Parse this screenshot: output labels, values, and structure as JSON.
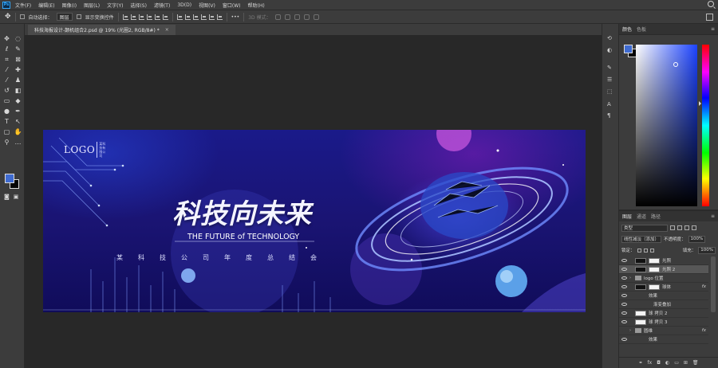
{
  "menubar": {
    "app_icon": "Ps",
    "items": [
      "文件(F)",
      "编辑(E)",
      "图像(I)",
      "图层(L)",
      "文字(Y)",
      "选择(S)",
      "滤镜(T)",
      "3D(D)",
      "视图(V)",
      "窗口(W)",
      "帮助(H)"
    ]
  },
  "options": {
    "auto_select_label": "自动选择：",
    "auto_select_value": "图层",
    "show_transform_label": "显示变换控件",
    "mode_3d_label": "3D 模式："
  },
  "document": {
    "tab_title": "科技海报设计-颠机组合2.psd @ 19% (光圈2, RGB/8#) *",
    "close_glyph": "×"
  },
  "artboard": {
    "logo_text": "LOGO",
    "logo_sub": "某科技有限公司",
    "headline": "科技向未来",
    "tagline": "THE FUTURE of TECHNOLOGY",
    "summary": "某科技公司年度总结会"
  },
  "color_panel": {
    "tabs": [
      "颜色",
      "色板"
    ],
    "foreground": "#3f6bd1",
    "background": "#050505"
  },
  "layers_panel": {
    "tabs": [
      "图层",
      "通道",
      "路径"
    ],
    "filter_label": "类型",
    "blend_mode": "线性减淡（添加）",
    "opacity_label": "不透明度：",
    "opacity_value": "100%",
    "lock_label": "锁定：",
    "fill_label": "填充：",
    "fill_value": "100%",
    "items": [
      {
        "name": "光照",
        "type": "pair"
      },
      {
        "name": "光照 2",
        "type": "pair",
        "selected": true
      },
      {
        "name": "logo 位置",
        "type": "folder"
      },
      {
        "name": "球体",
        "type": "pair-fx"
      },
      {
        "name": "效果",
        "type": "effects"
      },
      {
        "name": "渐变叠加",
        "type": "effect"
      },
      {
        "name": "球 拷贝 2",
        "type": "white"
      },
      {
        "name": "球 拷贝 3",
        "type": "white"
      },
      {
        "name": "圆维",
        "type": "folder-fx"
      },
      {
        "name": "效果",
        "type": "effects"
      }
    ],
    "footer_icons": [
      "link-icon",
      "fx-icon",
      "mask-icon",
      "adjustment-icon",
      "folder-icon",
      "new-layer-icon",
      "trash-icon"
    ]
  }
}
